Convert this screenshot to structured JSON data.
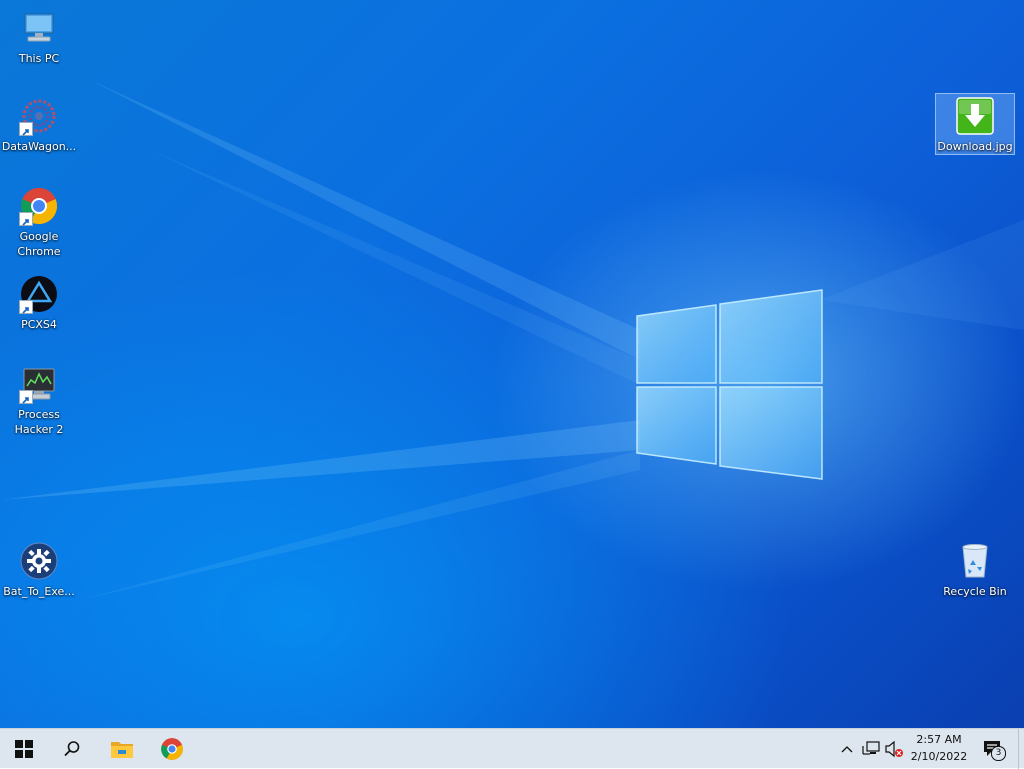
{
  "desktop": {
    "icons_left": [
      {
        "label": "This PC"
      },
      {
        "label": "DataWagon..."
      },
      {
        "label": "Google Chrome"
      },
      {
        "label": "PCXS4"
      },
      {
        "label": "Process Hacker 2"
      },
      {
        "label": "Bat_To_Exe..."
      }
    ],
    "icons_right": [
      {
        "label": "Download.jpg",
        "selected": true
      },
      {
        "label": "Recycle Bin"
      }
    ]
  },
  "taskbar": {
    "clock": {
      "time": "2:57 AM",
      "date": "2/10/2022"
    },
    "notifications": {
      "count": "3"
    },
    "colors": {
      "background": "#dde5ee",
      "accent": "#0078d7"
    }
  }
}
